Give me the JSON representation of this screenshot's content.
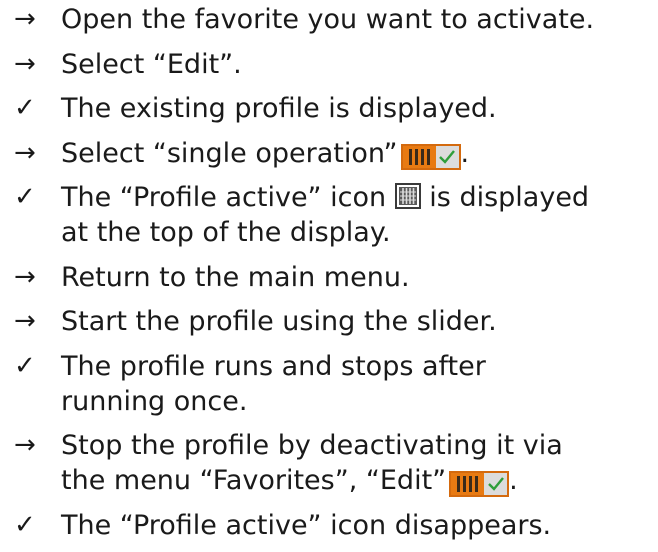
{
  "steps": [
    {
      "bullet": "→",
      "lines": [
        "Open the favorite you want to activate."
      ]
    },
    {
      "bullet": "→",
      "lines": [
        "Select “Edit”."
      ]
    },
    {
      "bullet": "✓",
      "lines": [
        "The existing profile is displayed."
      ]
    },
    {
      "bullet": "→",
      "text_before": "Select “single operation”",
      "text_after": "."
    },
    {
      "bullet": "✓",
      "text_before": "The “Profile active” icon",
      "text_after": "is displayed",
      "line2": "at the top of the display."
    },
    {
      "bullet": "→",
      "lines": [
        "Return to the main menu."
      ]
    },
    {
      "bullet": "→",
      "lines": [
        "Start the profile using the slider."
      ]
    },
    {
      "bullet": "✓",
      "lines": [
        "The profile runs and stops after",
        "running once."
      ]
    },
    {
      "bullet": "→",
      "line1": "Stop the profile by deactivating it via",
      "text_before": "the menu “Favorites”, “Edit”",
      "text_after": "."
    },
    {
      "bullet": "✓",
      "lines": [
        "The “Profile active” icon disappears."
      ]
    }
  ],
  "icons": {
    "single_operation": "single-operation-toggle-icon",
    "profile_active": "profile-active-icon"
  },
  "colors": {
    "toggle_orange": "#e87a12",
    "check_green": "#2f9e3a",
    "text": "#1a1a1a"
  }
}
